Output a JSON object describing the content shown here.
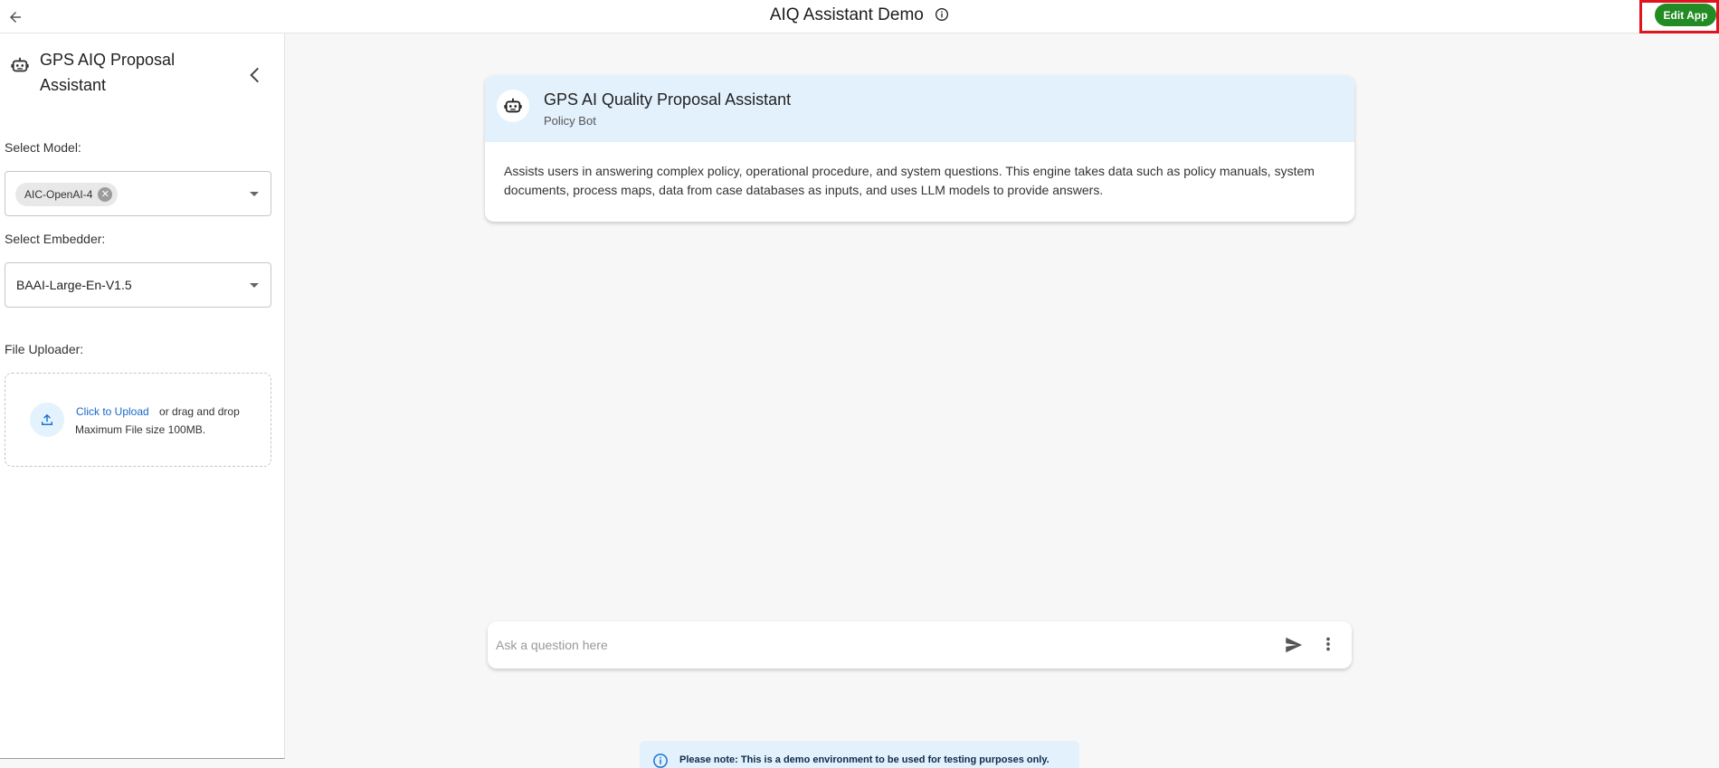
{
  "header": {
    "title": "AIQ Assistant Demo",
    "edit_button": "Edit App"
  },
  "sidebar": {
    "title": "GPS AIQ Proposal Assistant",
    "model_label": "Select Model:",
    "model_chip": "AIC-OpenAI-4",
    "embedder_label": "Select Embedder:",
    "embedder_value": "BAAI-Large-En-V1.5",
    "uploader_label": "File Uploader:",
    "upload_link": "Click to Upload",
    "upload_drag": "or drag and drop",
    "upload_max": "Maximum File size 100MB."
  },
  "bot_card": {
    "title": "GPS AI Quality Proposal Assistant",
    "subtitle": "Policy Bot",
    "description": "Assists users in answering complex policy, operational procedure, and system questions. This engine takes data such as policy manuals, system documents, process maps, data from case databases as inputs, and uses LLM models to provide answers."
  },
  "chat": {
    "placeholder": "Ask a question here"
  },
  "notice": {
    "prefix": "Please note:",
    "text": "This is a demo environment to be used for testing purposes only."
  },
  "colors": {
    "accent_green": "#238b23",
    "highlight_red": "#e0141e",
    "card_header_blue": "#e3f1fc",
    "link_blue": "#1769c8"
  },
  "icons": [
    "arrow-left-icon",
    "info-icon",
    "robot-icon",
    "chevron-left-icon",
    "upload-icon",
    "send-icon",
    "more-vertical-icon",
    "cancel-icon"
  ]
}
